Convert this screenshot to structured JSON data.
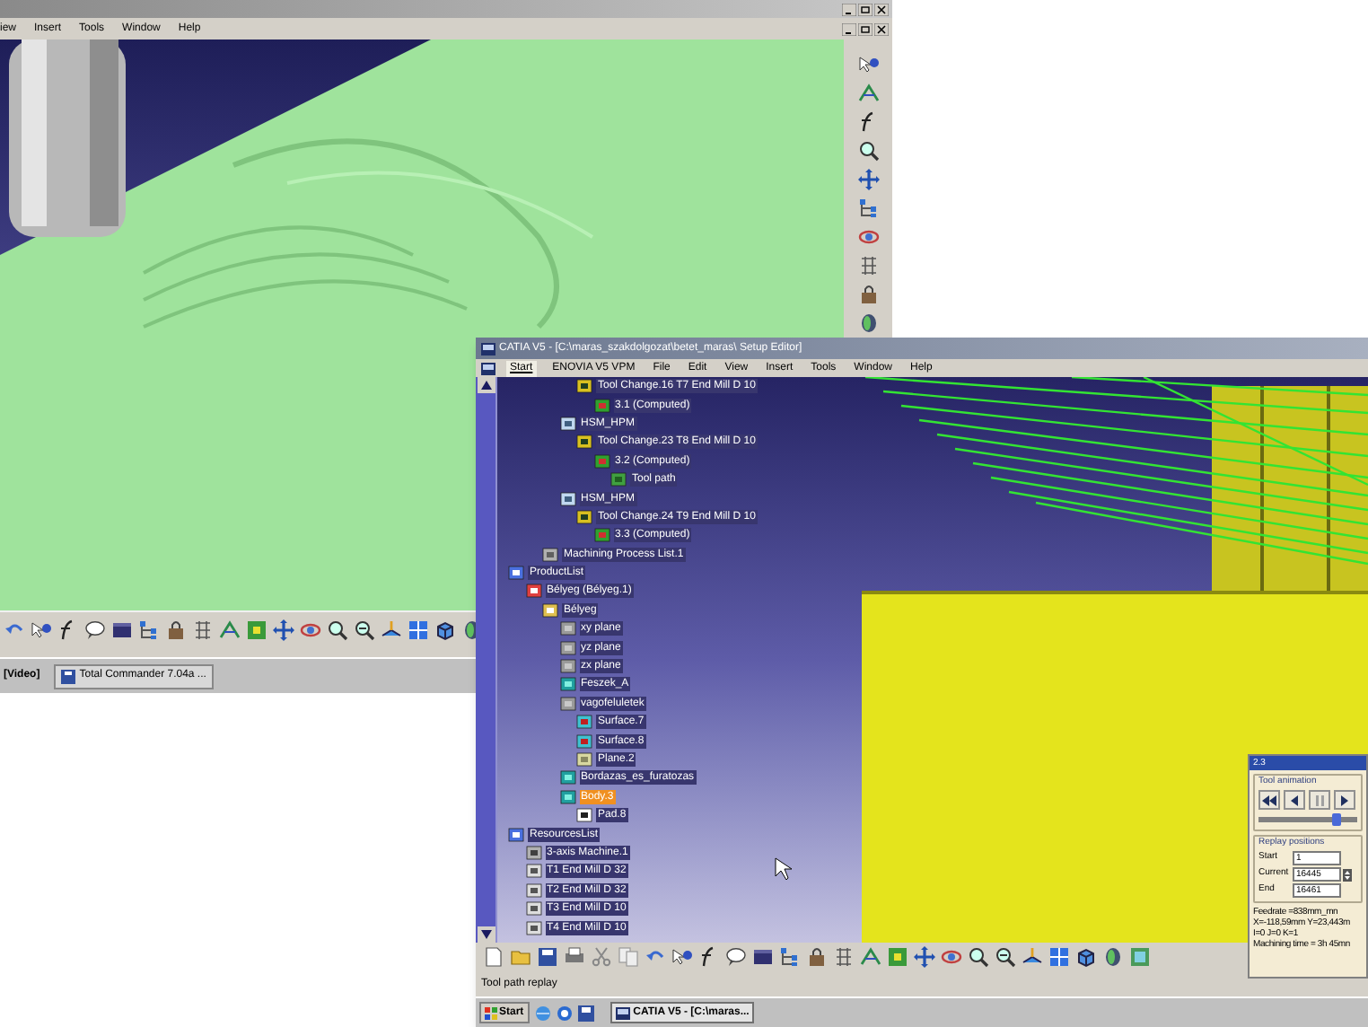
{
  "back_window": {
    "menu": [
      "iew",
      "Insert",
      "Tools",
      "Window",
      "Help"
    ],
    "taskbar": [
      {
        "label": "[Video]",
        "kind": "tail"
      },
      {
        "label": "Total Commander 7.04a ...",
        "kind": "button"
      }
    ]
  },
  "front_window": {
    "title": "CATIA V5 - [C:\\maras_szakdolgozat\\betet_maras\\ Setup Editor]",
    "menu": [
      {
        "label": "Start",
        "selected": true
      },
      {
        "label": "ENOVIA V5 VPM",
        "selected": false
      },
      {
        "label": "File",
        "selected": false
      },
      {
        "label": "Edit",
        "selected": false
      },
      {
        "label": "View",
        "selected": false
      },
      {
        "label": "Insert",
        "selected": false
      },
      {
        "label": "Tools",
        "selected": false
      },
      {
        "label": "Window",
        "selected": false
      },
      {
        "label": "Help",
        "selected": false
      }
    ],
    "tree": {
      "partial_operations": [
        {
          "label": "Tool Change.16  T7 End Mill D 10",
          "kind": "tool_change",
          "selected": false,
          "children": [
            {
              "label": "3.1 (Computed)",
              "kind": "computed",
              "selected": false
            }
          ]
        }
      ],
      "programs": [
        {
          "label": "HSM_HPM",
          "kind": "program",
          "selected": false,
          "children": [
            {
              "label": "Tool Change.23  T8 End Mill D 10",
              "kind": "tool_change",
              "selected": false,
              "children": [
                {
                  "label": "3.2 (Computed)",
                  "kind": "computed",
                  "selected": false,
                  "children": [
                    {
                      "label": "Tool path",
                      "kind": "toolpath",
                      "selected": false
                    }
                  ]
                }
              ]
            }
          ]
        },
        {
          "label": "HSM_HPM",
          "kind": "program",
          "selected": false,
          "children": [
            {
              "label": "Tool Change.24  T9 End Mill D 10",
              "kind": "tool_change",
              "selected": false,
              "children": [
                {
                  "label": "3.3 (Computed)",
                  "kind": "computed",
                  "selected": false
                }
              ]
            }
          ]
        }
      ],
      "process_items": [
        {
          "label": "Machining Process List.1",
          "kind": "process",
          "selected": false
        }
      ],
      "roots": [
        {
          "label": "ProductList",
          "kind": "list",
          "selected": false,
          "children": [
            {
              "label": "Bélyeg (Bélyeg.1)",
              "kind": "product",
              "selected": false,
              "children": [
                {
                  "label": "Bélyeg",
                  "kind": "part",
                  "selected": false,
                  "children": [
                    {
                      "label": "xy plane",
                      "kind": "plane",
                      "selected": false
                    },
                    {
                      "label": "yz plane",
                      "kind": "plane",
                      "selected": false
                    },
                    {
                      "label": "zx plane",
                      "kind": "plane",
                      "selected": false
                    },
                    {
                      "label": "Feszek_A",
                      "kind": "body",
                      "selected": false
                    },
                    {
                      "label": "vagofeluletek",
                      "kind": "plane",
                      "selected": false,
                      "children": [
                        {
                          "label": "Surface.7",
                          "kind": "surface",
                          "selected": false
                        },
                        {
                          "label": "Surface.8",
                          "kind": "surface",
                          "selected": false
                        },
                        {
                          "label": "Plane.2",
                          "kind": "flat",
                          "selected": false
                        }
                      ]
                    },
                    {
                      "label": "Bordazas_es_furatozas",
                      "kind": "body",
                      "selected": false
                    },
                    {
                      "label": "Body.3",
                      "kind": "body",
                      "selected": true,
                      "children": [
                        {
                          "label": "Pad.8",
                          "kind": "pad",
                          "selected": false
                        }
                      ]
                    }
                  ]
                }
              ]
            }
          ]
        },
        {
          "label": "ResourcesList",
          "kind": "list",
          "selected": false,
          "children": [
            {
              "label": "3-axis Machine.1",
              "kind": "machine",
              "selected": false
            },
            {
              "label": "T1 End Mill D 32",
              "kind": "tool",
              "selected": false
            },
            {
              "label": "T2 End Mill D 32",
              "kind": "tool",
              "selected": false
            },
            {
              "label": "T3 End Mill D 10",
              "kind": "tool",
              "selected": false
            },
            {
              "label": "T4 End Mill D 10",
              "kind": "tool",
              "selected": false
            }
          ]
        }
      ]
    },
    "dialog": {
      "title": "2.3",
      "animation_label": "Tool animation",
      "level": 0.78,
      "replay_label": "Replay positions",
      "fields": [
        {
          "label": "Start",
          "value": "1",
          "kind": "plain"
        },
        {
          "label": "Current",
          "value": "16445",
          "kind": "spinner"
        },
        {
          "label": "End",
          "value": "16461",
          "kind": "plain"
        }
      ],
      "info": [
        "Feedrate =838mm_mn",
        "X=-118,59mm Y=23,443m",
        "I=0 J=0 K=1",
        "Machining time = 3h 45mn"
      ]
    },
    "status": "Tool path replay",
    "taskbar": {
      "start": "Start",
      "tasks": [
        "CATIA V5 - [C:\\maras..."
      ]
    }
  }
}
